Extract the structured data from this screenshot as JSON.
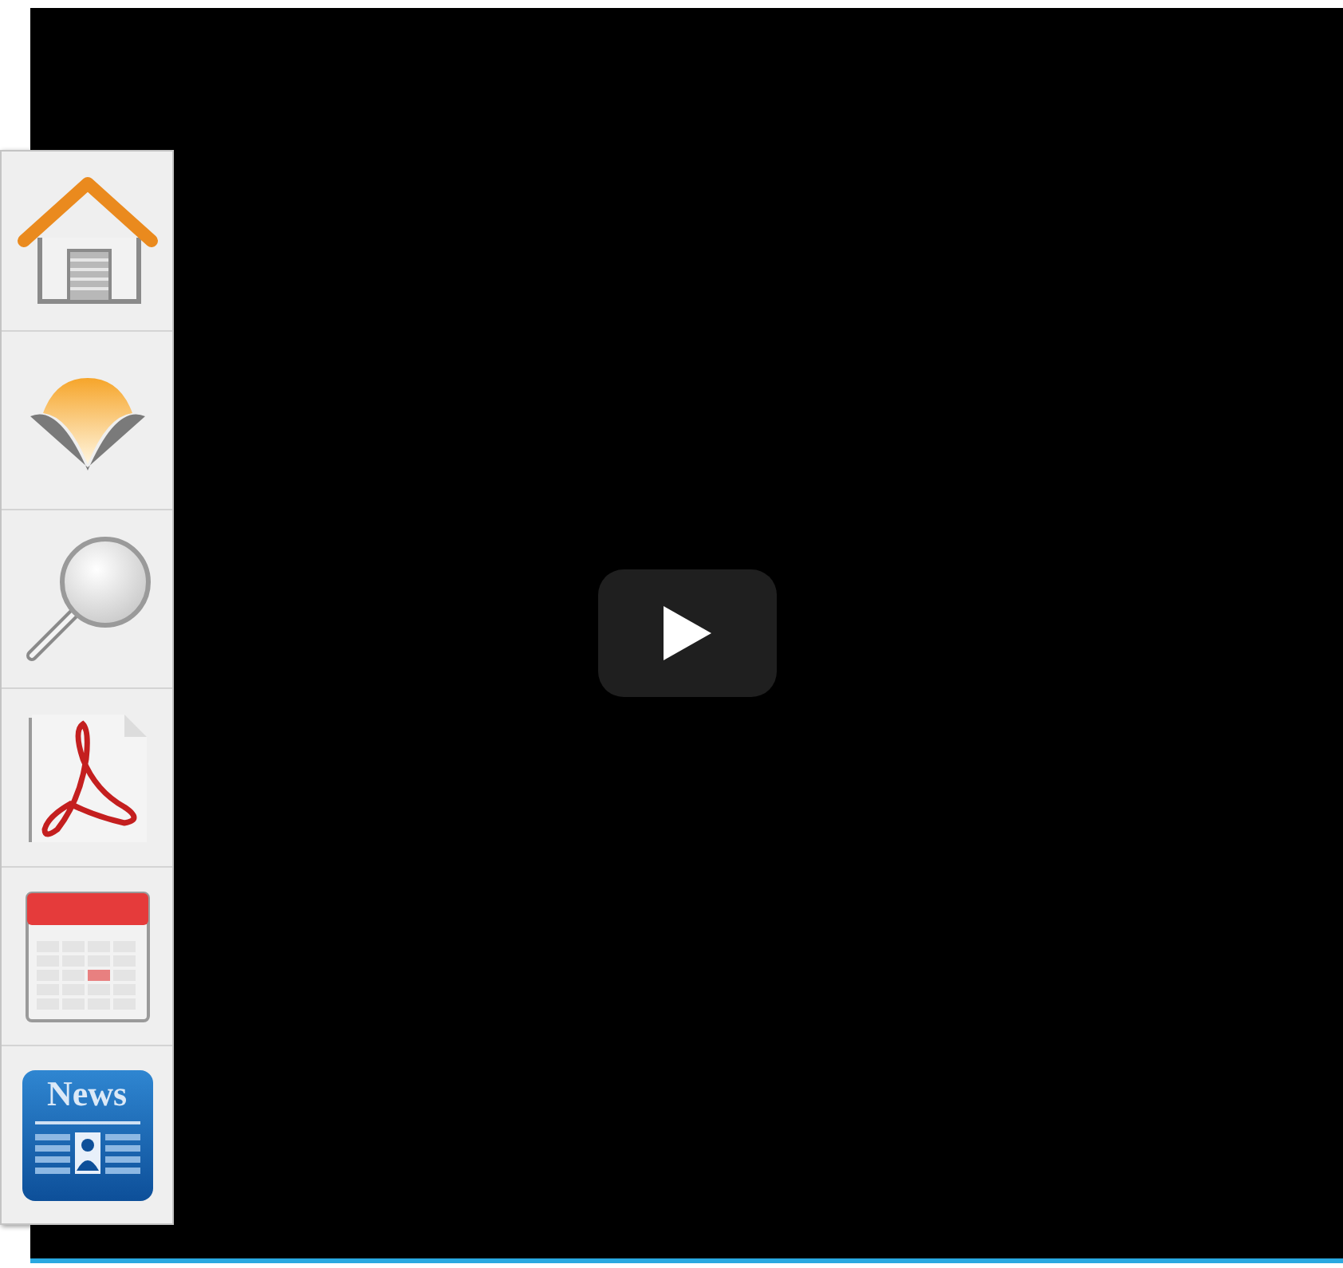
{
  "video": {
    "kind": "video",
    "play_button": true
  },
  "sidebar": {
    "items": [
      {
        "kind": "home"
      },
      {
        "kind": "bookmark"
      },
      {
        "kind": "search"
      },
      {
        "kind": "pdf"
      },
      {
        "kind": "calendar"
      },
      {
        "kind": "news",
        "label": "News"
      }
    ]
  }
}
